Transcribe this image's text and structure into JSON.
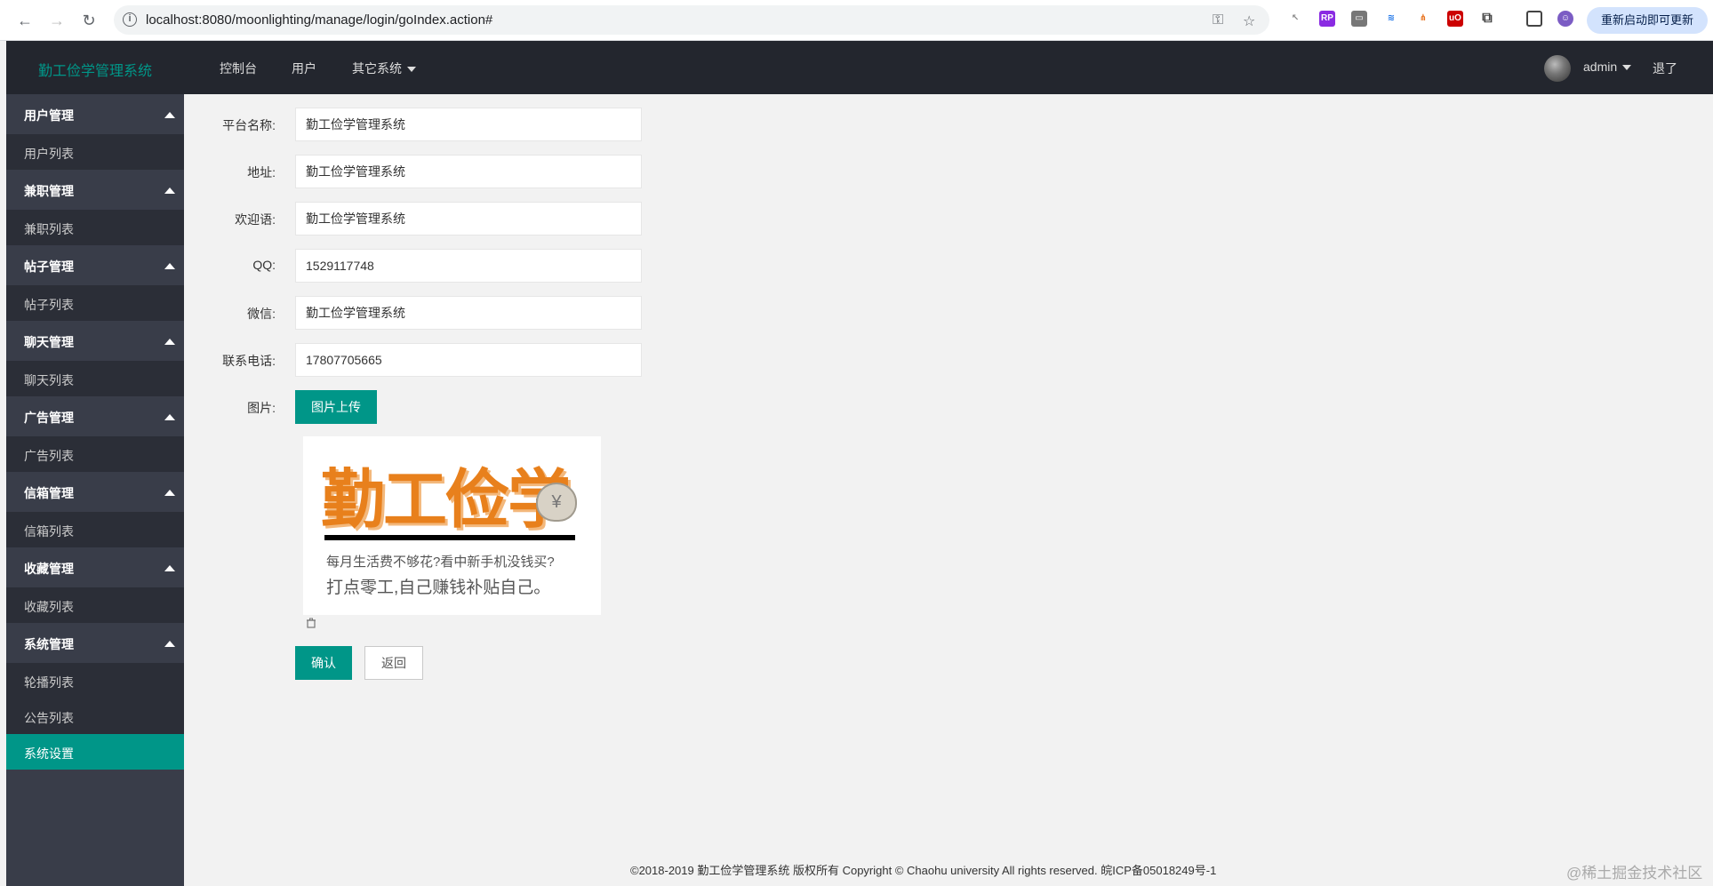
{
  "browser": {
    "url": "localhost:8080/moonlighting/manage/login/goIndex.action#",
    "update_label": "重新启动即可更新"
  },
  "header": {
    "logo": "勤工俭学管理系统",
    "nav": [
      {
        "label": "控制台"
      },
      {
        "label": "用户"
      },
      {
        "label": "其它系统"
      }
    ],
    "user": "admin",
    "logout": "退了"
  },
  "sidebar": {
    "groups": [
      {
        "label": "用户管理",
        "items": [
          "用户列表"
        ]
      },
      {
        "label": "兼职管理",
        "items": [
          "兼职列表"
        ]
      },
      {
        "label": "帖子管理",
        "items": [
          "帖子列表"
        ]
      },
      {
        "label": "聊天管理",
        "items": [
          "聊天列表"
        ]
      },
      {
        "label": "广告管理",
        "items": [
          "广告列表"
        ]
      },
      {
        "label": "信箱管理",
        "items": [
          "信箱列表"
        ]
      },
      {
        "label": "收藏管理",
        "items": [
          "收藏列表"
        ]
      },
      {
        "label": "系统管理",
        "items": [
          "轮播列表",
          "公告列表",
          "系统设置"
        ]
      }
    ],
    "active_item": "系统设置"
  },
  "form": {
    "fields": [
      {
        "label": "平台名称:",
        "value": "勤工俭学管理系统"
      },
      {
        "label": "地址:",
        "value": "勤工俭学管理系统"
      },
      {
        "label": "欢迎语:",
        "value": "勤工俭学管理系统"
      },
      {
        "label": "QQ:",
        "value": "1529117748"
      },
      {
        "label": "微信:",
        "value": "勤工俭学管理系统"
      },
      {
        "label": "联系电话:",
        "value": "17807705665"
      }
    ],
    "image_label": "图片:",
    "upload_button": "图片上传",
    "image_preview": {
      "title": "勤工俭学",
      "yen": "¥",
      "line1": "每月生活费不够花?看中新手机没钱买?",
      "line2": "打点零工,自己赚钱补贴自己。"
    },
    "confirm_button": "确认",
    "back_button": "返回"
  },
  "footer": {
    "text": "©2018-2019 勤工俭学管理系统 版权所有  Copyright © Chaohu university All rights reserved. 皖ICP备05018249号-1"
  },
  "watermark": "@稀土掘金技术社区",
  "colors": {
    "accent": "#009688",
    "header_bg": "#23262e",
    "sidebar_bg": "#393d49"
  }
}
